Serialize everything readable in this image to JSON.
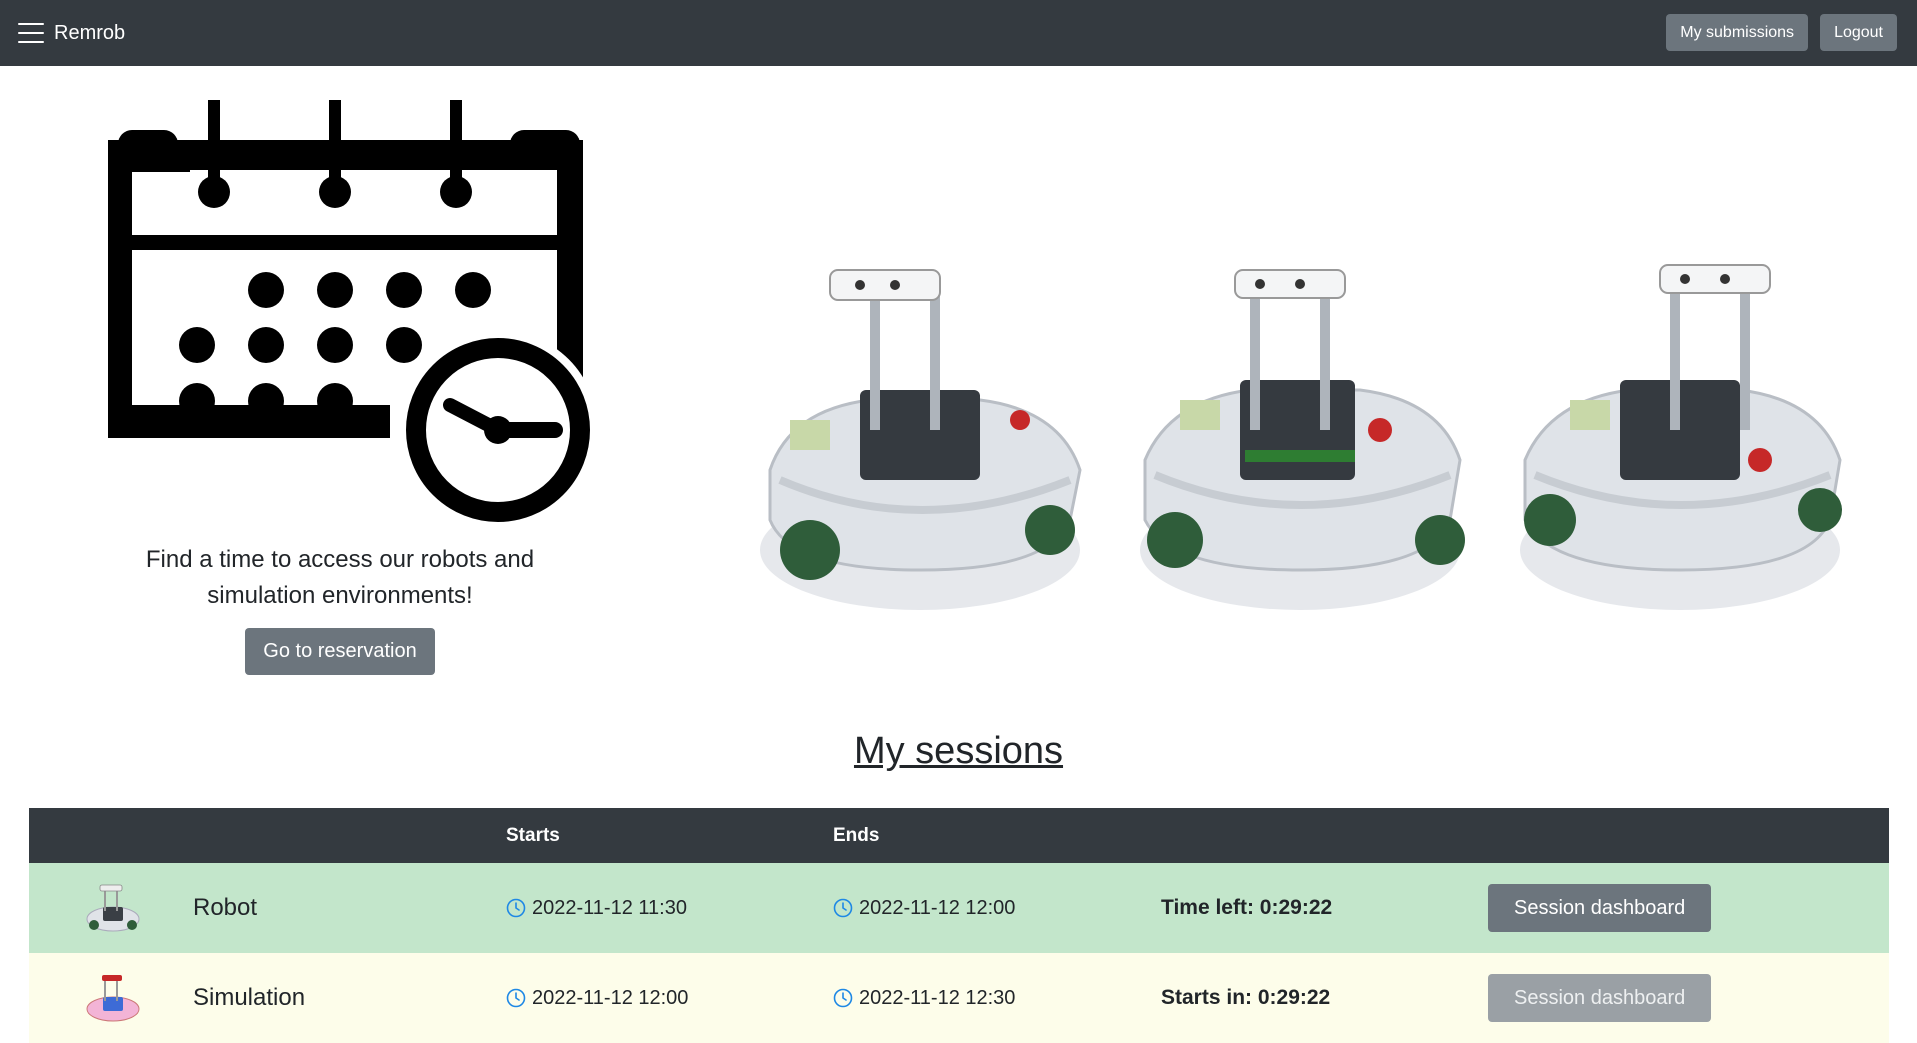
{
  "navbar": {
    "brand": "Remrob",
    "menu_icon": "hamburger-icon",
    "buttons": {
      "submissions": "My submissions",
      "logout": "Logout"
    }
  },
  "hero": {
    "icon": "calendar-clock-icon",
    "text": "Find a time to access our robots and simulation environments!",
    "button": "Go to reservation"
  },
  "sessions": {
    "title": "My sessions",
    "headers": {
      "image": "",
      "name": "",
      "starts": "Starts",
      "ends": "Ends",
      "time": "",
      "action": ""
    },
    "rows": [
      {
        "name": "Robot",
        "starts": "2022-11-12 11:30",
        "ends": "2022-11-12 12:00",
        "time": "Time left: 0:29:22",
        "button": "Session dashboard",
        "status": "active"
      },
      {
        "name": "Simulation",
        "starts": "2022-11-12 12:00",
        "ends": "2022-11-12 12:30",
        "time": "Starts in: 0:29:22",
        "button": "Session dashboard",
        "status": "upcoming"
      }
    ]
  },
  "colors": {
    "navbar": "#343a40",
    "button": "#6c757d",
    "active_row": "#c3e6cb",
    "upcoming_row": "#fdfdea",
    "clock_icon": "#1e88e5"
  }
}
